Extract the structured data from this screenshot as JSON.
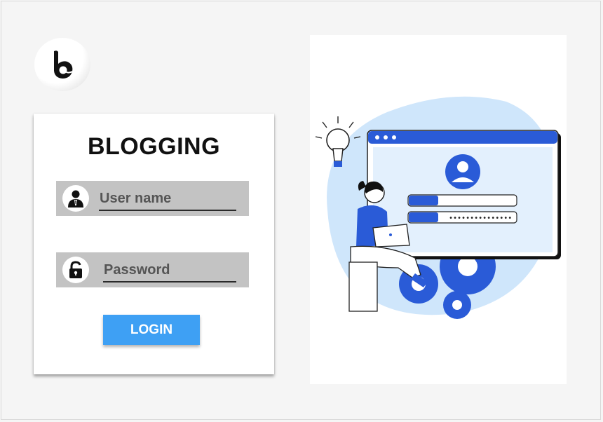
{
  "brand": {
    "logo_icon": "b-letter-logo-icon"
  },
  "login_card": {
    "title": "BLOGGING",
    "username": {
      "label": "User name",
      "icon": "user-icon"
    },
    "password": {
      "label": "Password",
      "icon": "lock-icon"
    },
    "login_button": "LOGIN"
  },
  "illustration": {
    "icon": "login-illustration"
  },
  "colors": {
    "accent": "#3ea0f4",
    "field_bg": "#c3c3c3",
    "illustration_blue": "#2a5bd7",
    "illustration_light": "#cfe6fb"
  }
}
